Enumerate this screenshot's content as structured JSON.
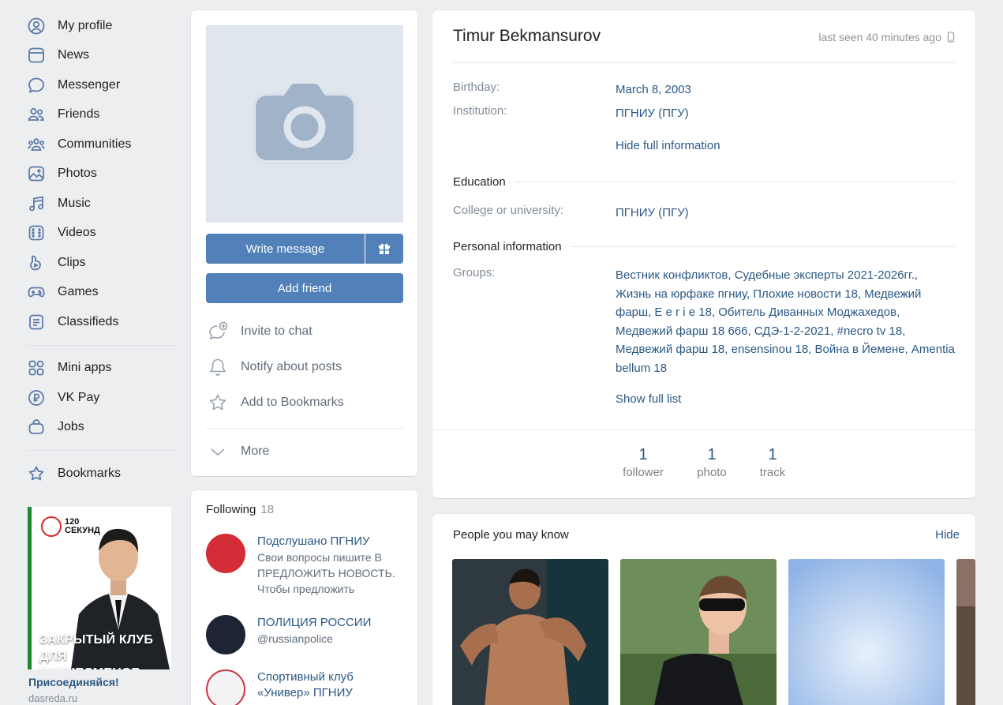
{
  "nav": {
    "items": [
      {
        "label": "My profile",
        "icon": "user-circle-icon"
      },
      {
        "label": "News",
        "icon": "news-icon"
      },
      {
        "label": "Messenger",
        "icon": "message-icon"
      },
      {
        "label": "Friends",
        "icon": "friends-icon"
      },
      {
        "label": "Communities",
        "icon": "communities-icon"
      },
      {
        "label": "Photos",
        "icon": "photos-icon"
      },
      {
        "label": "Music",
        "icon": "music-icon"
      },
      {
        "label": "Videos",
        "icon": "videos-icon"
      },
      {
        "label": "Clips",
        "icon": "clips-icon"
      },
      {
        "label": "Games",
        "icon": "games-icon"
      },
      {
        "label": "Classifieds",
        "icon": "classifieds-icon"
      }
    ],
    "items2": [
      {
        "label": "Mini apps",
        "icon": "mini-apps-icon"
      },
      {
        "label": "VK Pay",
        "icon": "vk-pay-icon"
      },
      {
        "label": "Jobs",
        "icon": "jobs-icon"
      }
    ],
    "bookmarks": {
      "label": "Bookmarks",
      "icon": "star-icon"
    }
  },
  "ad": {
    "brand_line1": "120",
    "brand_line2": "СЕКУНД",
    "caption_line1": "ЗАКРЫТЫЙ КЛУБ",
    "caption_line2": "ДЛЯ БИЗНЕСМЕНОВ",
    "link": "Присоединяйся!",
    "domain": "dasreda.ru"
  },
  "profile_actions": {
    "write_message": "Write message",
    "add_friend": "Add friend",
    "invite_chat": "Invite to chat",
    "notify_posts": "Notify about posts",
    "add_bookmarks": "Add to Bookmarks",
    "more": "More"
  },
  "following": {
    "title": "Following",
    "count": "18",
    "items": [
      {
        "name": "Подслушано ПГНИУ",
        "sub": "Свои вопросы пишите В ПРЕДЛОЖИТЬ НОВОСТЬ. Чтобы предложить"
      },
      {
        "name": "ПОЛИЦИЯ РОССИИ",
        "sub": "@russianpolice"
      },
      {
        "name": "Спортивный клуб «Универ» ПГНИУ",
        "sub": ""
      }
    ]
  },
  "profile": {
    "name": "Timur Bekmansurov",
    "last_seen": "last seen 40 minutes ago",
    "birthday_label": "Birthday:",
    "birthday": "March 8, 2003",
    "institution_label": "Institution:",
    "institution": "ПГНИУ (ПГУ)",
    "hide_full": "Hide full information",
    "education_title": "Education",
    "college_label": "College or university:",
    "college": "ПГНИУ (ПГУ)",
    "personal_title": "Personal information",
    "groups_label": "Groups:",
    "groups": "Вестник конфликтов, Судебные эксперты 2021-2026гг., Жизнь на юрфаке пгниу, Плохие новости 18, Медвежий фарш, E e r i e 18, Обитель Диванных Моджахедов, Медвежий фарш 18 666, СДЭ-1-2-2021, #necro tv 18, Медвежий фарш 18, ensensinou 18, Война в Йемене, Amentia bellum 18",
    "show_full_list": "Show full list"
  },
  "counters": [
    {
      "n": "1",
      "label": "follower"
    },
    {
      "n": "1",
      "label": "photo"
    },
    {
      "n": "1",
      "label": "track"
    }
  ],
  "pymk": {
    "title": "People you may know",
    "hide": "Hide"
  },
  "colors": {
    "accent": "#5181b8",
    "link": "#2a5885",
    "background": "#edeef0"
  }
}
